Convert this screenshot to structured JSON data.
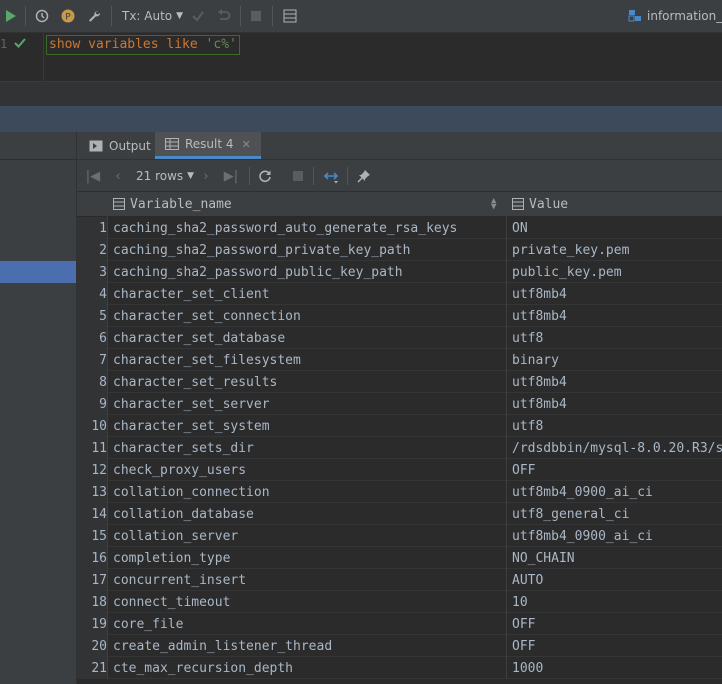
{
  "toolbar": {
    "tx_label": "Tx: Auto",
    "schema_label": "information_sc",
    "icons": [
      "run-icon",
      "history-icon",
      "profile-icon",
      "settings-wrench-icon",
      "commit-icon",
      "rollback-icon",
      "stop-icon",
      "output-grid-icon",
      "database-icon"
    ]
  },
  "editor": {
    "line_number": "1",
    "sql_keyword": "show variables like ",
    "sql_string": "'c%'"
  },
  "result_tabs": [
    {
      "label": "Output"
    },
    {
      "label": "Result 4"
    }
  ],
  "result_toolbar": {
    "rows_label": "21 rows"
  },
  "grid": {
    "columns": [
      "Variable_name",
      "Value"
    ],
    "rows": [
      {
        "n": "1",
        "name": "caching_sha2_password_auto_generate_rsa_keys",
        "value": "ON"
      },
      {
        "n": "2",
        "name": "caching_sha2_password_private_key_path",
        "value": "private_key.pem"
      },
      {
        "n": "3",
        "name": "caching_sha2_password_public_key_path",
        "value": "public_key.pem"
      },
      {
        "n": "4",
        "name": "character_set_client",
        "value": "utf8mb4"
      },
      {
        "n": "5",
        "name": "character_set_connection",
        "value": "utf8mb4"
      },
      {
        "n": "6",
        "name": "character_set_database",
        "value": "utf8"
      },
      {
        "n": "7",
        "name": "character_set_filesystem",
        "value": "binary"
      },
      {
        "n": "8",
        "name": "character_set_results",
        "value": "utf8mb4"
      },
      {
        "n": "9",
        "name": "character_set_server",
        "value": "utf8mb4"
      },
      {
        "n": "10",
        "name": "character_set_system",
        "value": "utf8"
      },
      {
        "n": "11",
        "name": "character_sets_dir",
        "value": "/rdsdbbin/mysql-8.0.20.R3/s"
      },
      {
        "n": "12",
        "name": "check_proxy_users",
        "value": "OFF"
      },
      {
        "n": "13",
        "name": "collation_connection",
        "value": "utf8mb4_0900_ai_ci"
      },
      {
        "n": "14",
        "name": "collation_database",
        "value": "utf8_general_ci"
      },
      {
        "n": "15",
        "name": "collation_server",
        "value": "utf8mb4_0900_ai_ci"
      },
      {
        "n": "16",
        "name": "completion_type",
        "value": "NO_CHAIN"
      },
      {
        "n": "17",
        "name": "concurrent_insert",
        "value": "AUTO"
      },
      {
        "n": "18",
        "name": "connect_timeout",
        "value": "10"
      },
      {
        "n": "19",
        "name": "core_file",
        "value": "OFF"
      },
      {
        "n": "20",
        "name": "create_admin_listener_thread",
        "value": "OFF"
      },
      {
        "n": "21",
        "name": "cte_max_recursion_depth",
        "value": "1000"
      }
    ]
  },
  "colors": {
    "accent": "#4a88c7",
    "run_green": "#59a869",
    "selection": "#4b6eaf",
    "sql_keyword": "#cc7832",
    "sql_string": "#6a8759"
  }
}
